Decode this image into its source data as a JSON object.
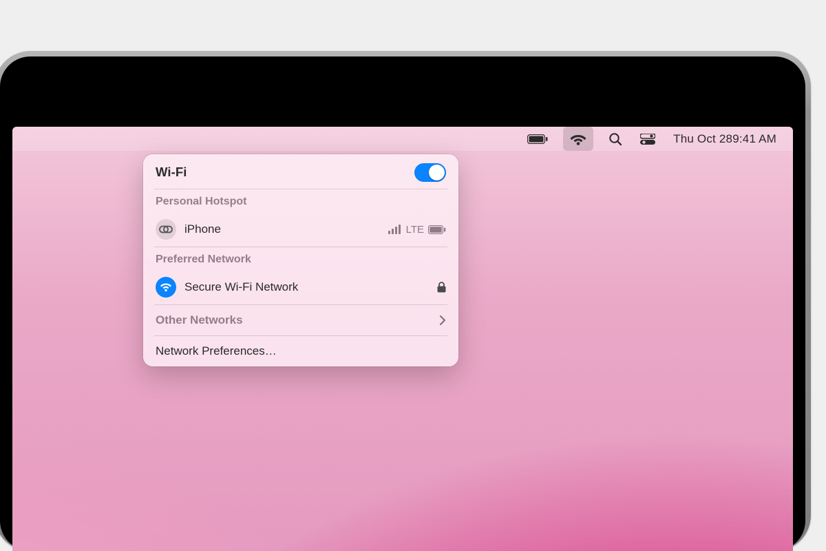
{
  "menubar": {
    "date": "Thu Oct 28",
    "time": "9:41 AM"
  },
  "panel": {
    "title": "Wi-Fi",
    "wifi_on": true,
    "sections": {
      "hotspot_header": "Personal Hotspot",
      "hotspot_name": "iPhone",
      "hotspot_signal": "LTE",
      "preferred_header": "Preferred Network",
      "preferred_name": "Secure Wi-Fi Network",
      "other_header": "Other Networks",
      "prefs_link": "Network Preferences…"
    }
  }
}
